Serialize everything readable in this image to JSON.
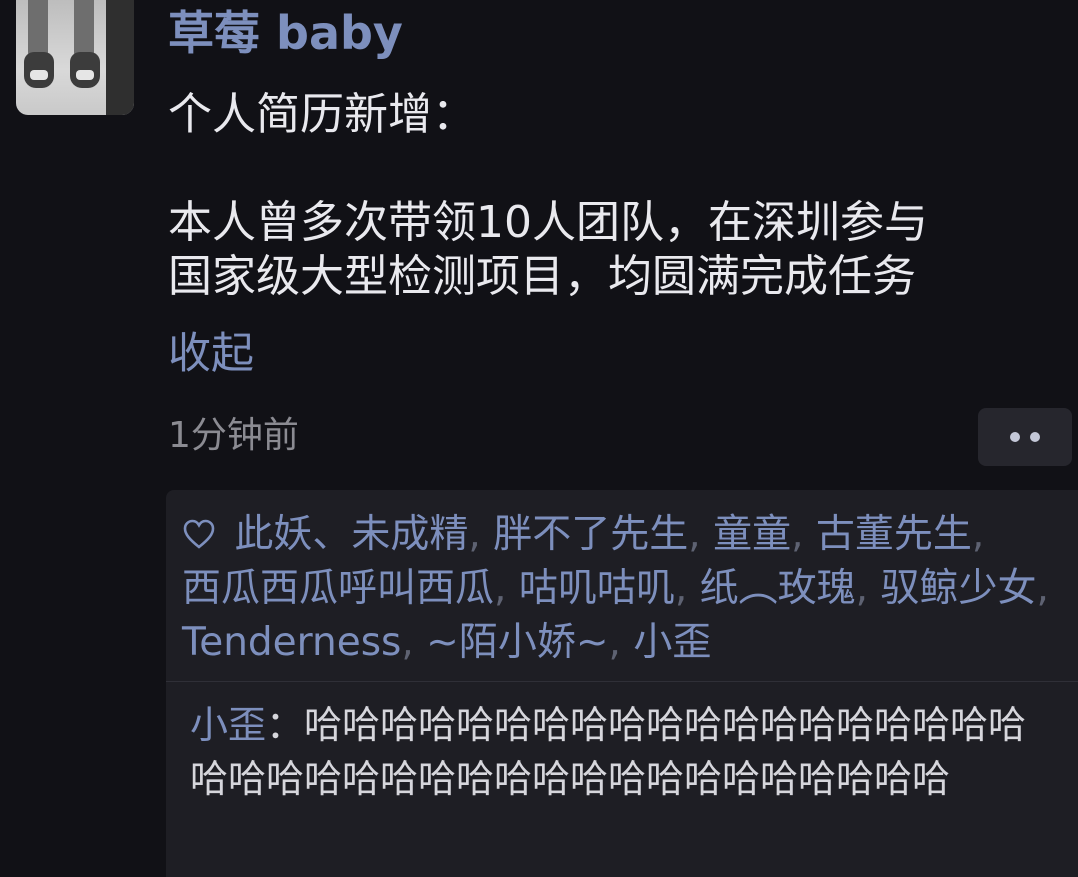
{
  "post": {
    "author": "草莓 baby",
    "text_lines": [
      "个人简历新增：",
      "本人曾多次带领10人团队，在深圳参与",
      "国家级大型检测项目，均圆满完成任务"
    ],
    "collapse_label": "收起",
    "timestamp": "1分钟前"
  },
  "likes": {
    "icon": "heart-outline-icon",
    "names": [
      "此妖、未成精",
      "胖不了先生",
      "童童",
      "古董先生",
      "西瓜西瓜呼叫西瓜",
      "咕叽咕叽",
      "纸︵玫瑰",
      "驭鲸少女",
      "Tenderness",
      "~陌小娇~",
      "小歪"
    ],
    "separator": ","
  },
  "comment": {
    "author": "小歪",
    "colon": "：",
    "text": "哈哈哈哈哈哈哈哈哈哈哈哈哈哈哈哈哈哈哈哈哈哈哈哈哈哈哈哈哈哈哈哈哈哈哈哈哈哈哈"
  },
  "colors": {
    "background": "#111116",
    "link_blue": "#7d8fbd",
    "panel": "#1e1e24"
  }
}
